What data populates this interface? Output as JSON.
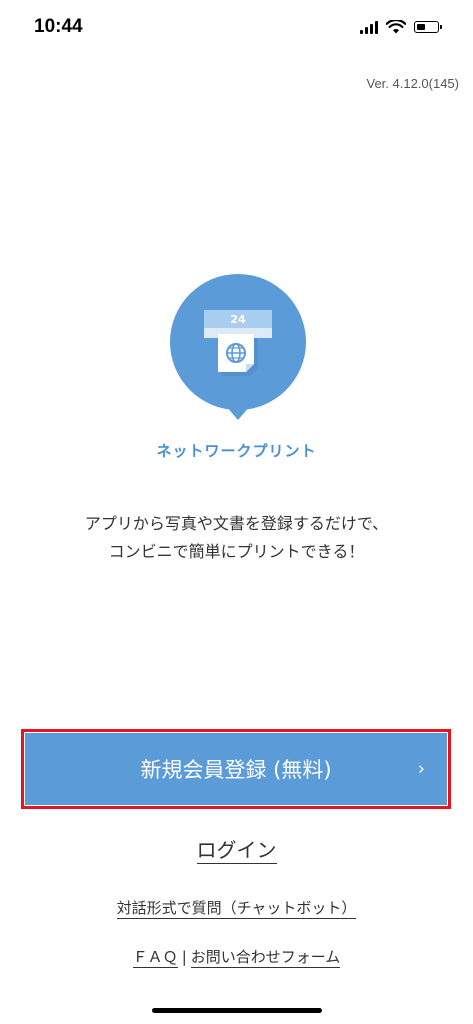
{
  "status_bar": {
    "time": "10:44"
  },
  "version": "Ver. 4.12.0(145)",
  "logo": {
    "badge_number": "24",
    "accent_color": "#5b9bd8"
  },
  "brand_name": "ネットワークプリント",
  "tagline": {
    "line1": "アプリから写真や文書を登録するだけで、",
    "line2": "コンビニで簡単にプリントできる！"
  },
  "register_button": {
    "label": "新規会員登録 (無料)",
    "chevron": "›",
    "highlight_color": "#e8141f"
  },
  "login_link": "ログイン",
  "chatbot_link": "対話形式で質問（チャットボット）",
  "footer": {
    "faq": "ＦＡＱ",
    "separator": "|",
    "contact": "お問い合わせフォーム"
  }
}
